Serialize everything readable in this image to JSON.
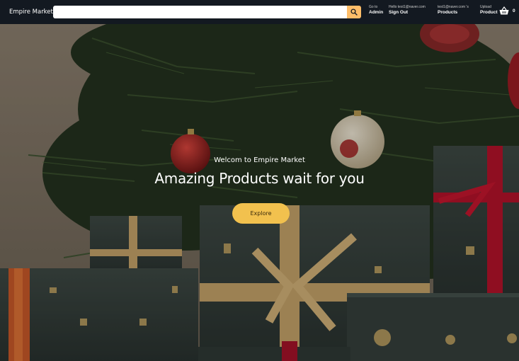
{
  "navbar": {
    "brand": "Empire Market",
    "search_placeholder": "",
    "search_icon": "magnifier-icon",
    "admin": {
      "line1": "Go to",
      "line2": "Admin"
    },
    "account": {
      "line1": "Hello test1@naver.com",
      "line2": "Sign Out"
    },
    "products": {
      "line1": "test1@naver.com 's",
      "line2": "Products"
    },
    "upload": {
      "line1": "Upload",
      "line2": "Product"
    },
    "cart": {
      "icon": "basket-icon",
      "count": "0"
    }
  },
  "hero": {
    "welcome": "Welcom to Empire Market",
    "headline": "Amazing Products wait for you",
    "button_label": "Explore"
  },
  "colors": {
    "navbar": "#131921",
    "search_button": "#febd69",
    "explore_button": "#f2c14e"
  }
}
